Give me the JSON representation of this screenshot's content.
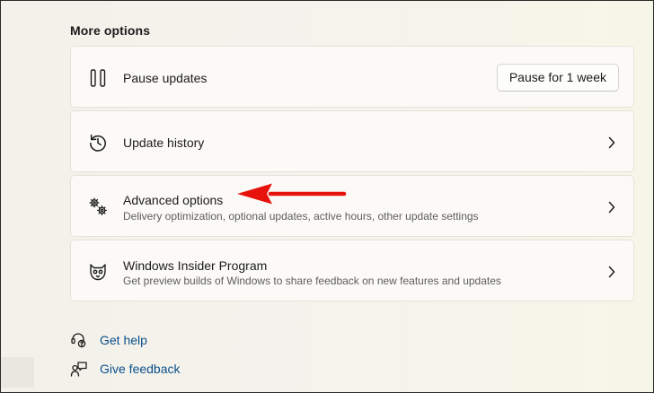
{
  "section": {
    "title": "More options"
  },
  "cards": {
    "pause": {
      "title": "Pause updates",
      "icon": "pause-icon",
      "button_label": "Pause for 1 week"
    },
    "history": {
      "title": "Update history",
      "icon": "history-icon"
    },
    "advanced": {
      "title": "Advanced options",
      "subtitle": "Delivery optimization, optional updates, active hours, other update settings",
      "icon": "gears-icon"
    },
    "insider": {
      "title": "Windows Insider Program",
      "subtitle": "Get preview builds of Windows to share feedback on new features and updates",
      "icon": "insider-cat-icon"
    }
  },
  "links": {
    "help": {
      "label": "Get help",
      "icon": "help-headset-icon"
    },
    "feedback": {
      "label": "Give feedback",
      "icon": "feedback-icon"
    }
  },
  "annotation": {
    "arrow_color": "#e8120c"
  }
}
